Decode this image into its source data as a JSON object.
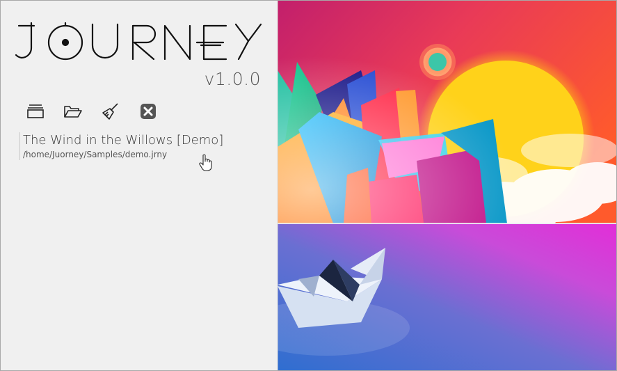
{
  "app": {
    "title": "JOURNEY",
    "version": "v1.0.0"
  },
  "toolbar": [
    {
      "name": "new-project-icon",
      "label": "New project"
    },
    {
      "name": "open-folder-icon",
      "label": "Open project"
    },
    {
      "name": "clear-broom-icon",
      "label": "Clear recent"
    },
    {
      "name": "close-x-icon",
      "label": "Close"
    }
  ],
  "recent_projects": [
    {
      "title": "The Wind in the Willows [Demo]",
      "path": "/home/Juorney/Samples/demo.jrny"
    }
  ],
  "colors": {
    "panel_bg": "#f0f0f0",
    "text": "#3a3a3a",
    "art_magenta": "#e8248e",
    "art_sun": "#ffd21a",
    "art_sky_top": "#e6236e",
    "art_sea_blue": "#3c7fd0"
  }
}
